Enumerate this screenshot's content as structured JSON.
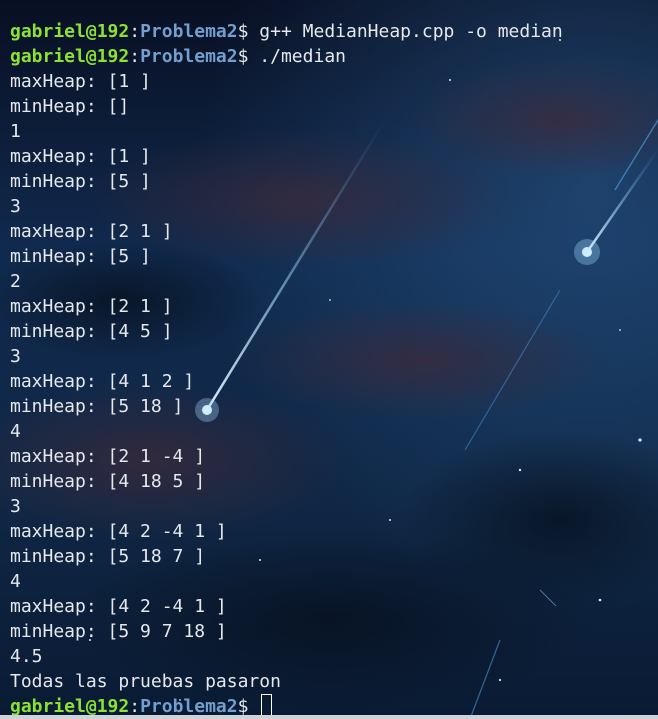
{
  "terminal": {
    "prompt": {
      "user_host": "gabriel@192",
      "separator": ":",
      "path": "Problema2",
      "symbol": "$ "
    },
    "commands": {
      "compile": "g++ MedianHeap.cpp -o median",
      "run": "./median"
    },
    "output_lines": [
      "maxHeap: [1 ]",
      "minHeap: []",
      "1",
      "maxHeap: [1 ]",
      "minHeap: [5 ]",
      "3",
      "maxHeap: [2 1 ]",
      "minHeap: [5 ]",
      "2",
      "maxHeap: [2 1 ]",
      "minHeap: [4 5 ]",
      "3",
      "maxHeap: [4 1 2 ]",
      "minHeap: [5 18 ]",
      "4",
      "maxHeap: [2 1 -4 ]",
      "minHeap: [4 18 5 ]",
      "3",
      "maxHeap: [4 2 -4 1 ]",
      "minHeap: [5 18 7 ]",
      "4",
      "maxHeap: [4 2 -4 1 ]",
      "minHeap: [5 9 7 18 ]",
      "4.5",
      "Todas las pruebas pasaron"
    ]
  },
  "colors": {
    "user_host": "#8ae234",
    "path": "#729fcf",
    "text": "#e6e8ec",
    "background": "#0c1830"
  }
}
